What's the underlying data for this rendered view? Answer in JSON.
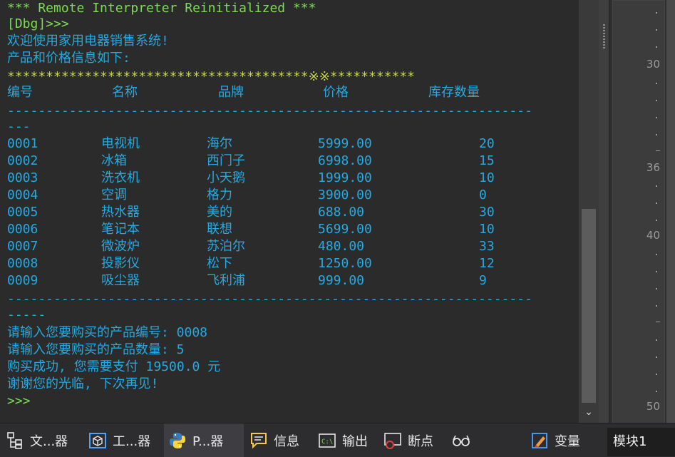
{
  "console": {
    "header": "*** Remote Interpreter Reinitialized ***",
    "prompt_dbg": "[Dbg]>>>",
    "welcome": "欢迎使用家用电器销售系统!",
    "info": "产品和价格信息如下:",
    "stars": "***************************************※※***********",
    "columns": [
      "编号",
      "名称",
      "品牌",
      "价格",
      "库存数量"
    ],
    "divider_main": "--------------------------------------------------------------------",
    "divider_tail1": "---",
    "divider_tail2": "-----",
    "rows": [
      [
        "0001",
        "电视机",
        "海尔",
        "5999.00",
        "20"
      ],
      [
        "0002",
        "冰箱",
        "西门子",
        "6998.00",
        "15"
      ],
      [
        "0003",
        "洗衣机",
        "小天鹅",
        "1999.00",
        "10"
      ],
      [
        "0004",
        "空调",
        "格力",
        "3900.00",
        "0"
      ],
      [
        "0005",
        "热水器",
        "美的",
        "688.00",
        "30"
      ],
      [
        "0006",
        "笔记本",
        "联想",
        "5699.00",
        "10"
      ],
      [
        "0007",
        "微波炉",
        "苏泊尔",
        "480.00",
        "33"
      ],
      [
        "0008",
        "投影仪",
        "松下",
        "1250.00",
        "12"
      ],
      [
        "0009",
        "吸尘器",
        "飞利浦",
        "999.00",
        "9"
      ]
    ],
    "input_id": "请输入您要购买的产品编号: 0008",
    "input_qty": "请输入您要购买的产品数量: 5",
    "success": "购买成功, 您需要支付 19500.0 元",
    "thanks": "谢谢您的光临, 下次再见!",
    "prompt": ">>>"
  },
  "editor": {
    "line_numbers": [
      "30",
      "36",
      "40",
      "50"
    ]
  },
  "tabs": [
    {
      "label": "文...器",
      "icon": "file-browser-icon"
    },
    {
      "label": "工...器",
      "icon": "project-cube-icon"
    },
    {
      "label": "P...器",
      "icon": "python-icon"
    },
    {
      "label": "信息",
      "icon": "message-icon"
    },
    {
      "label": "输出",
      "icon": "output-console-icon"
    },
    {
      "label": "断点",
      "icon": "breakpoint-icon"
    },
    {
      "label": "",
      "icon": "watch-glasses-icon"
    },
    {
      "label": "变量",
      "icon": "variables-pencil-icon"
    }
  ],
  "module_tab": "模块1"
}
